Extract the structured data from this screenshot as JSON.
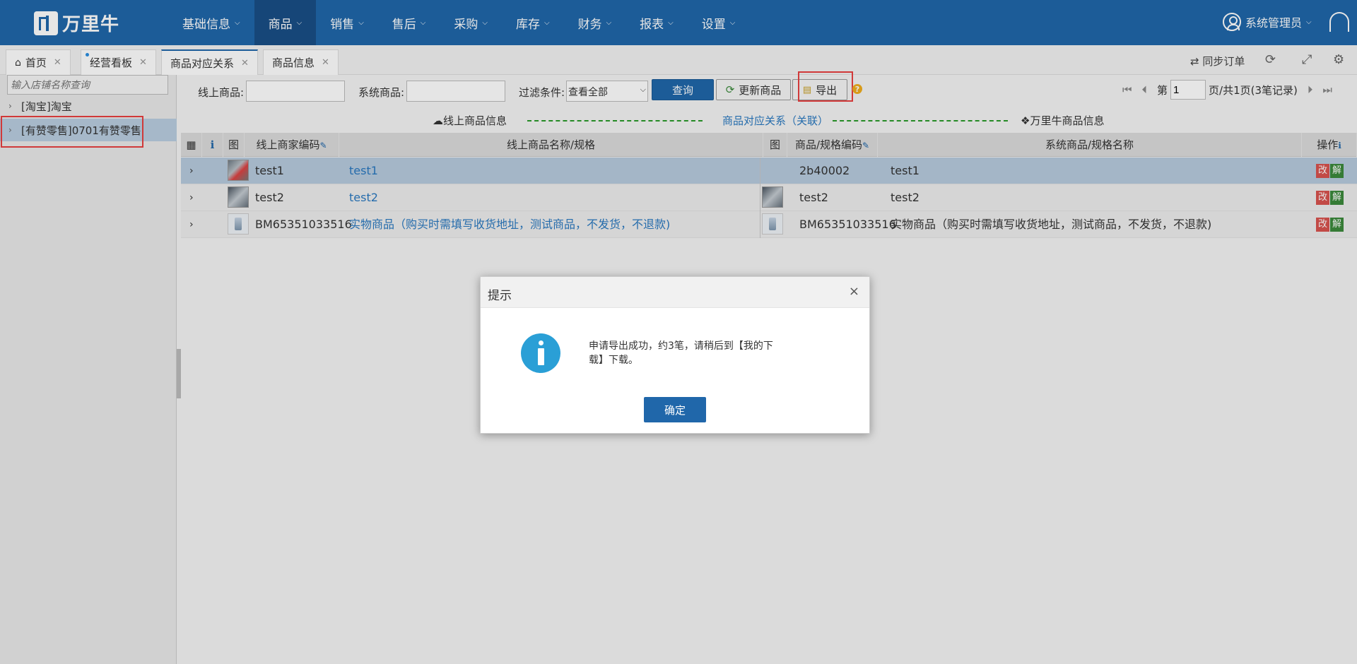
{
  "app": {
    "logo_text": "万里牛",
    "user": "系统管理员",
    "brand_color": "#2067aa"
  },
  "nav": [
    {
      "label": "基础信息"
    },
    {
      "label": "商品"
    },
    {
      "label": "销售"
    },
    {
      "label": "售后"
    },
    {
      "label": "采购"
    },
    {
      "label": "库存"
    },
    {
      "label": "财务"
    },
    {
      "label": "报表"
    },
    {
      "label": "设置"
    }
  ],
  "tabs": [
    {
      "label": "首页"
    },
    {
      "label": "经营看板"
    },
    {
      "label": "商品对应关系"
    },
    {
      "label": "商品信息"
    }
  ],
  "toolbar_right": {
    "sync_label": "同步订单"
  },
  "left": {
    "search_placeholder": "输入店铺名称查询",
    "shops": [
      "[淘宝]淘宝",
      "[有赞零售]0701有赞零售"
    ]
  },
  "filters": {
    "online_label": "线上商品:",
    "system_label": "系统商品:",
    "filter_label": "过滤条件:",
    "filter_value": "查看全部",
    "query_btn": "查询",
    "update_btn": "更新商品",
    "export_btn": "导出"
  },
  "pager": {
    "prefix": "第",
    "page": "1",
    "suffix": "页/共1页(3笔记录)"
  },
  "legend": {
    "left": "线上商品信息",
    "mid": "商品对应关系（关联）",
    "right": "万里牛商品信息"
  },
  "table": {
    "headers": {
      "img": "图",
      "online_code": "线上商家编码",
      "online_name": "线上商品名称/规格",
      "img2": "图",
      "sku_code": "商品/规格编码",
      "sys_name": "系统商品/规格名称",
      "ops": "操作"
    },
    "rows": [
      {
        "online_code": "test1",
        "online_name": "test1",
        "sku_code": "2b40002",
        "sys_name": "test1"
      },
      {
        "online_code": "test2",
        "online_name": "test2",
        "sku_code": "test2",
        "sys_name": "test2"
      },
      {
        "online_code": "BM65351033516",
        "online_name": "实物商品（购买时需填写收货地址，测试商品，不发货，不退款)",
        "sku_code": "BM65351033516",
        "sys_name": "实物商品（购买时需填写收货地址，测试商品，不发货，不退款)"
      }
    ],
    "edit_label": "改",
    "unlink_label": "解"
  },
  "modal": {
    "title": "提示",
    "message": "申请导出成功，约3笔，请稍后到【我的下载】下载。",
    "ok": "确定"
  }
}
